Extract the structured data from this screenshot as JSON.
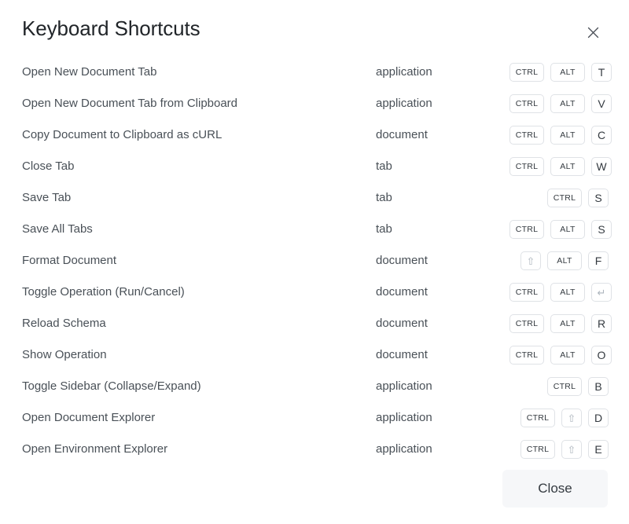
{
  "dialog": {
    "title": "Keyboard Shortcuts",
    "close_icon": "close-icon"
  },
  "footer": {
    "close_label": "Close"
  },
  "colors": {
    "title_text": "#212529",
    "row_text": "#495057",
    "keycap_border": "#dfe2e6",
    "keycap_text": "#343a40",
    "keycap_symbol_text": "#adb5bd",
    "footer_button_bg": "#f6f7f9",
    "background": "#ffffff"
  },
  "shortcuts": [
    {
      "name": "Open New Document Tab",
      "category": "application",
      "keys": [
        {
          "label": "CTRL",
          "type": "mod"
        },
        {
          "label": "ALT",
          "type": "mod"
        },
        {
          "label": "T",
          "type": "letter"
        }
      ]
    },
    {
      "name": "Open New Document Tab from Clipboard",
      "category": "application",
      "keys": [
        {
          "label": "CTRL",
          "type": "mod"
        },
        {
          "label": "ALT",
          "type": "mod"
        },
        {
          "label": "V",
          "type": "letter"
        }
      ]
    },
    {
      "name": "Copy Document to Clipboard as cURL",
      "category": "document",
      "keys": [
        {
          "label": "CTRL",
          "type": "mod"
        },
        {
          "label": "ALT",
          "type": "mod"
        },
        {
          "label": "C",
          "type": "letter"
        }
      ]
    },
    {
      "name": "Close Tab",
      "category": "tab",
      "keys": [
        {
          "label": "CTRL",
          "type": "mod"
        },
        {
          "label": "ALT",
          "type": "mod"
        },
        {
          "label": "W",
          "type": "letter"
        }
      ]
    },
    {
      "name": "Save Tab",
      "category": "tab",
      "keys": [
        {
          "label": "CTRL",
          "type": "mod"
        },
        {
          "label": "S",
          "type": "letter"
        }
      ]
    },
    {
      "name": "Save All Tabs",
      "category": "tab",
      "keys": [
        {
          "label": "CTRL",
          "type": "mod"
        },
        {
          "label": "ALT",
          "type": "mod"
        },
        {
          "label": "S",
          "type": "letter"
        }
      ]
    },
    {
      "name": "Format Document",
      "category": "document",
      "keys": [
        {
          "label": "⇧",
          "type": "symbol"
        },
        {
          "label": "ALT",
          "type": "mod"
        },
        {
          "label": "F",
          "type": "letter"
        }
      ]
    },
    {
      "name": "Toggle Operation (Run/Cancel)",
      "category": "document",
      "keys": [
        {
          "label": "CTRL",
          "type": "mod"
        },
        {
          "label": "ALT",
          "type": "mod"
        },
        {
          "label": "↵",
          "type": "symbol"
        }
      ]
    },
    {
      "name": "Reload Schema",
      "category": "document",
      "keys": [
        {
          "label": "CTRL",
          "type": "mod"
        },
        {
          "label": "ALT",
          "type": "mod"
        },
        {
          "label": "R",
          "type": "letter"
        }
      ]
    },
    {
      "name": "Show Operation",
      "category": "document",
      "keys": [
        {
          "label": "CTRL",
          "type": "mod"
        },
        {
          "label": "ALT",
          "type": "mod"
        },
        {
          "label": "O",
          "type": "letter"
        }
      ]
    },
    {
      "name": "Toggle Sidebar (Collapse/Expand)",
      "category": "application",
      "keys": [
        {
          "label": "CTRL",
          "type": "mod"
        },
        {
          "label": "B",
          "type": "letter"
        }
      ]
    },
    {
      "name": "Open Document Explorer",
      "category": "application",
      "keys": [
        {
          "label": "CTRL",
          "type": "mod"
        },
        {
          "label": "⇧",
          "type": "symbol"
        },
        {
          "label": "D",
          "type": "letter"
        }
      ]
    },
    {
      "name": "Open Environment Explorer",
      "category": "application",
      "keys": [
        {
          "label": "CTRL",
          "type": "mod"
        },
        {
          "label": "⇧",
          "type": "symbol"
        },
        {
          "label": "E",
          "type": "letter"
        }
      ]
    }
  ]
}
